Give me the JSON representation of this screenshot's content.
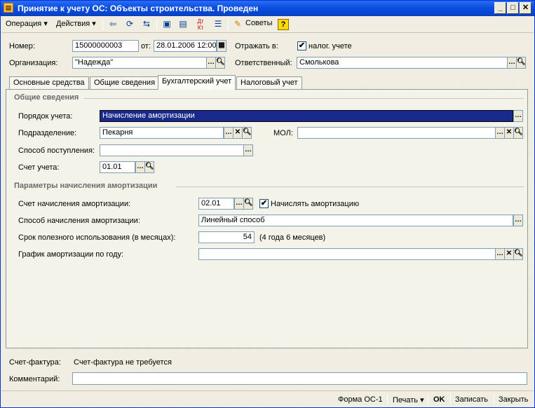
{
  "window": {
    "title": "Принятие к учету ОС: Объекты строительства. Проведен"
  },
  "toolbar": {
    "operation": "Операция",
    "actions": "Действия",
    "tips": "Советы",
    "help": "?"
  },
  "header": {
    "number_label": "Номер:",
    "number_value": "15000000003",
    "date_label": "от:",
    "date_value": "28.01.2006 12:00:00",
    "reflect_label": "Отражать в:",
    "tax_label": "налог. учете",
    "tax_checked": "✔",
    "org_label": "Организация:",
    "org_value": "\"Надежда\"",
    "resp_label": "Ответственный:",
    "resp_value": "Смолькова"
  },
  "tabs": [
    "Основные средства",
    "Общие сведения",
    "Бухгалтерский учет",
    "Налоговый учет"
  ],
  "general": {
    "section_title": "Общие сведения",
    "order_label": "Порядок учета:",
    "order_value": "Начисление амортизации",
    "division_label": "Подразделение:",
    "division_value": "Пекарня",
    "mol_label": "МОЛ:",
    "mol_value": "",
    "receipt_label": "Способ поступления:",
    "receipt_value": "",
    "account_label": "Счет учета:",
    "account_value": "01.01"
  },
  "depr": {
    "section_title": "Параметры начисления амортизации",
    "account_label": "Счет начисления амортизации:",
    "account_value": "02.01",
    "accrue_label": "Начислять амортизацию",
    "accrue_checked": "✔",
    "method_label": "Способ начисления амортизации:",
    "method_value": "Линейный способ",
    "term_label": "Срок полезного использования (в месяцах):",
    "term_value": "54",
    "term_note": "(4 года 6 месяцев)",
    "schedule_label": "График амортизации по году:",
    "schedule_value": ""
  },
  "footer": {
    "invoice_label": "Счет-фактура:",
    "invoice_value": "Счет-фактура не требуется",
    "comment_label": "Комментарий:",
    "comment_value": ""
  },
  "statusbar": {
    "form": "Форма ОС-1",
    "print": "Печать",
    "ok": "OK",
    "save": "Записать",
    "close": "Закрыть"
  }
}
